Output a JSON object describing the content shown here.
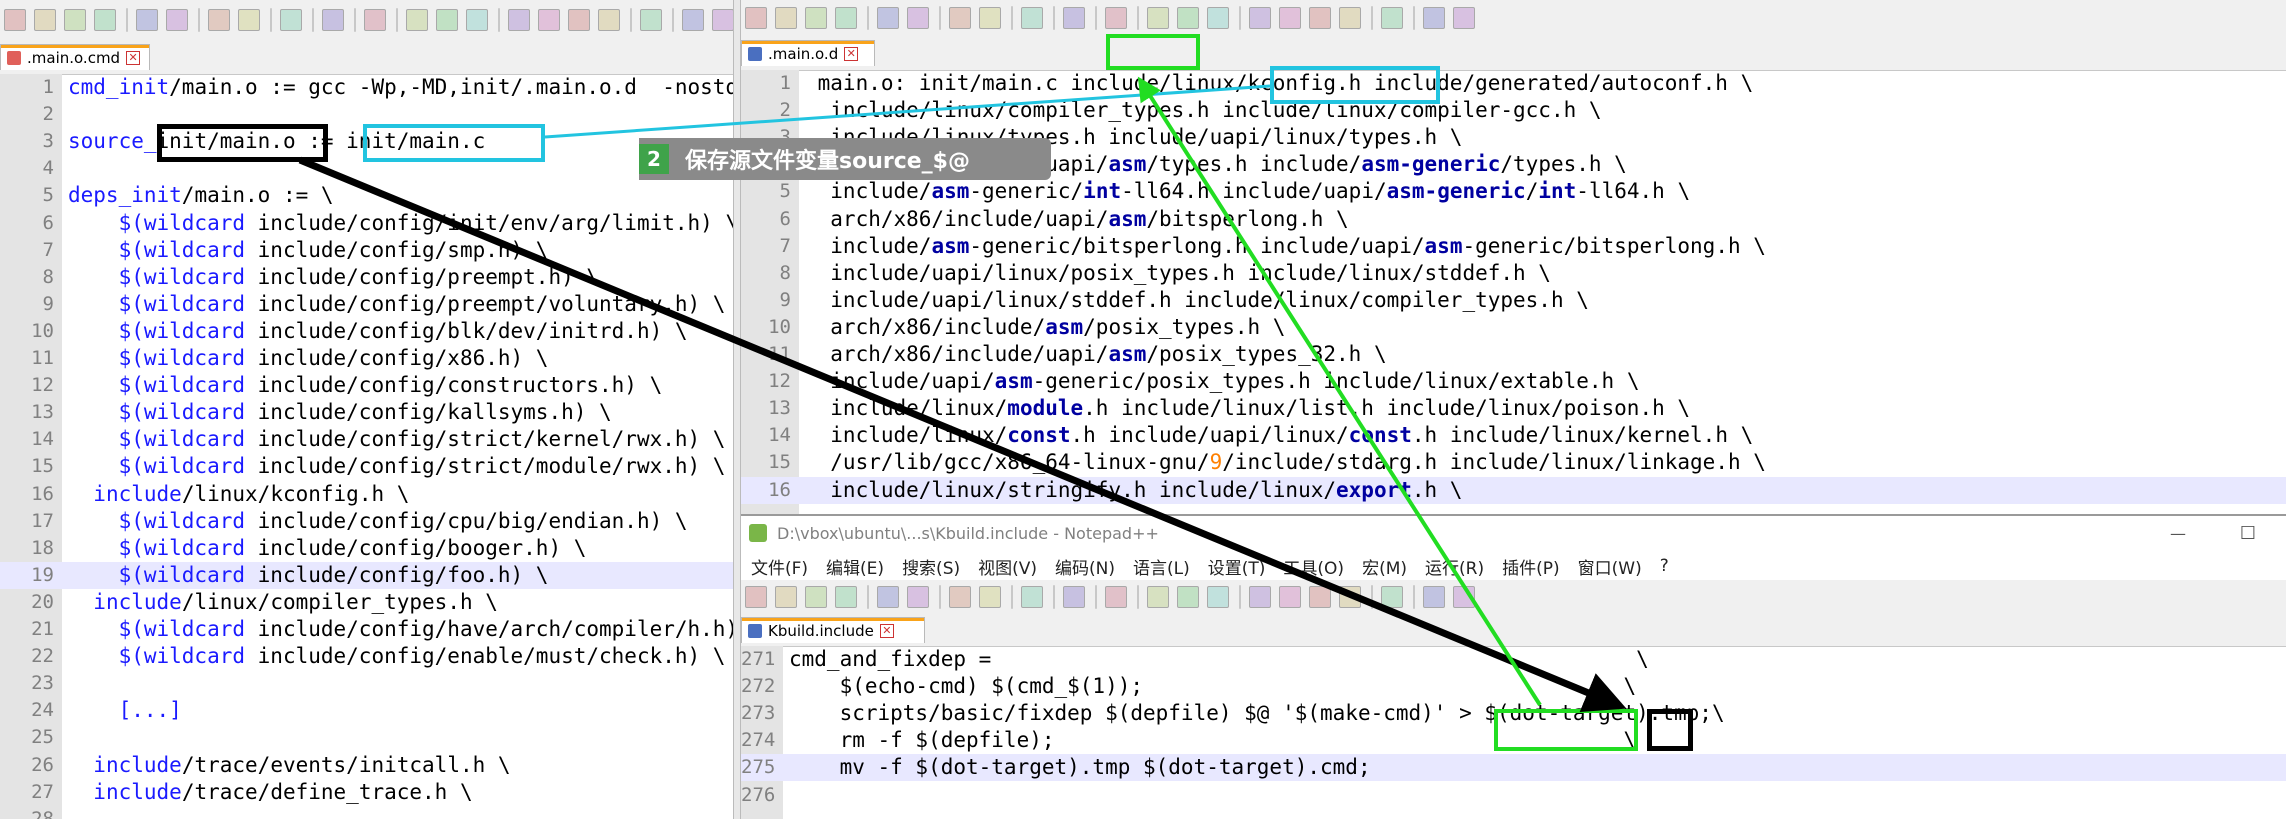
{
  "left_tab": {
    "label": ".main.o.cmd"
  },
  "left_lines": [
    {
      "n": "1",
      "t": [
        [
          "v",
          "cmd_init"
        ],
        [
          "p",
          "/main.o := gcc -Wp,-MD,init/.main.o.d  -nostdinc -isystem /usr/l"
        ]
      ]
    },
    {
      "n": "2",
      "t": []
    },
    {
      "n": "3",
      "t": [
        [
          "v",
          "source_"
        ],
        [
          "p",
          "init/main.o := init/main.c"
        ]
      ]
    },
    {
      "n": "4",
      "t": []
    },
    {
      "n": "5",
      "t": [
        [
          "v",
          "deps_init"
        ],
        [
          "p",
          "/main.o := \\"
        ]
      ]
    },
    {
      "n": "6",
      "t": [
        [
          "v",
          "    $(wildcard"
        ],
        [
          "p",
          " include/config/init/env/arg/limit.h) \\"
        ]
      ]
    },
    {
      "n": "7",
      "t": [
        [
          "v",
          "    $(wildcard"
        ],
        [
          "p",
          " include/config/smp.h) \\"
        ]
      ]
    },
    {
      "n": "8",
      "t": [
        [
          "v",
          "    $(wildcard"
        ],
        [
          "p",
          " include/config/preempt.h) \\"
        ]
      ]
    },
    {
      "n": "9",
      "t": [
        [
          "v",
          "    $(wildcard"
        ],
        [
          "p",
          " include/config/preempt/voluntary.h) \\"
        ]
      ]
    },
    {
      "n": "10",
      "t": [
        [
          "v",
          "    $(wildcard"
        ],
        [
          "p",
          " include/config/blk/dev/initrd.h) \\"
        ]
      ]
    },
    {
      "n": "11",
      "t": [
        [
          "v",
          "    $(wildcard"
        ],
        [
          "p",
          " include/config/x86.h) \\"
        ]
      ]
    },
    {
      "n": "12",
      "t": [
        [
          "v",
          "    $(wildcard"
        ],
        [
          "p",
          " include/config/constructors.h) \\"
        ]
      ]
    },
    {
      "n": "13",
      "t": [
        [
          "v",
          "    $(wildcard"
        ],
        [
          "p",
          " include/config/kallsyms.h) \\"
        ]
      ]
    },
    {
      "n": "14",
      "t": [
        [
          "v",
          "    $(wildcard"
        ],
        [
          "p",
          " include/config/strict/kernel/rwx.h) \\"
        ]
      ]
    },
    {
      "n": "15",
      "t": [
        [
          "v",
          "    $(wildcard"
        ],
        [
          "p",
          " include/config/strict/module/rwx.h) \\"
        ]
      ]
    },
    {
      "n": "16",
      "t": [
        [
          "p",
          "  "
        ],
        [
          "v",
          "include"
        ],
        [
          "p",
          "/linux/kconfig.h \\"
        ]
      ]
    },
    {
      "n": "17",
      "t": [
        [
          "v",
          "    $(wildcard"
        ],
        [
          "p",
          " include/config/cpu/big/endian.h) \\"
        ]
      ]
    },
    {
      "n": "18",
      "t": [
        [
          "v",
          "    $(wildcard"
        ],
        [
          "p",
          " include/config/booger.h) \\"
        ]
      ]
    },
    {
      "n": "19",
      "t": [
        [
          "v",
          "    $(wildcard"
        ],
        [
          "p",
          " include/config/foo.h) \\"
        ]
      ]
    },
    {
      "n": "20",
      "t": [
        [
          "p",
          "  "
        ],
        [
          "v",
          "include"
        ],
        [
          "p",
          "/linux/compiler_types.h \\"
        ]
      ]
    },
    {
      "n": "21",
      "t": [
        [
          "v",
          "    $(wildcard"
        ],
        [
          "p",
          " include/config/have/arch/compiler/h.h) \\"
        ]
      ]
    },
    {
      "n": "22",
      "t": [
        [
          "v",
          "    $(wildcard"
        ],
        [
          "p",
          " include/config/enable/must/check.h) \\"
        ]
      ]
    },
    {
      "n": "23",
      "t": []
    },
    {
      "n": "24",
      "t": [
        [
          "v",
          "    [...]"
        ]
      ]
    },
    {
      "n": "25",
      "t": []
    },
    {
      "n": "26",
      "t": [
        [
          "p",
          "  "
        ],
        [
          "v",
          "include"
        ],
        [
          "p",
          "/trace/events/initcall.h \\"
        ]
      ]
    },
    {
      "n": "27",
      "t": [
        [
          "p",
          "  "
        ],
        [
          "v",
          "include"
        ],
        [
          "p",
          "/trace/define_trace.h \\"
        ]
      ]
    },
    {
      "n": "28",
      "t": []
    }
  ],
  "right_tab": {
    "label": ".main.o.d"
  },
  "right_lines": [
    {
      "n": "1",
      "t": [
        [
          "p",
          " main.o: init/main.c include/linux/kconfig.h include/generated/autoconf.h \\"
        ]
      ]
    },
    {
      "n": "2",
      "t": [
        [
          "p",
          "  include/linux/compiler_types.h include/linux/compiler-gcc.h \\"
        ]
      ]
    },
    {
      "n": "3",
      "t": [
        [
          "p",
          "  include/linux/types.h include/uapi/linux/types.h \\"
        ]
      ]
    },
    {
      "n": "4",
      "t": [
        [
          "p",
          "  arch/x86/include/uapi/"
        ],
        [
          "k",
          "asm"
        ],
        [
          "p",
          "/types.h include/"
        ],
        [
          "k",
          "asm-generic"
        ],
        [
          "p",
          "/types.h \\"
        ]
      ]
    },
    {
      "n": "5",
      "t": [
        [
          "p",
          "  include/"
        ],
        [
          "k",
          "asm"
        ],
        [
          "p",
          "-generic/"
        ],
        [
          "k",
          "int"
        ],
        [
          "p",
          "-ll64.h include/uapi/"
        ],
        [
          "k",
          "asm-generic"
        ],
        [
          "p",
          "/"
        ],
        [
          "k",
          "int"
        ],
        [
          "p",
          "-ll64.h \\"
        ]
      ]
    },
    {
      "n": "6",
      "t": [
        [
          "p",
          "  arch/x86/include/uapi/"
        ],
        [
          "k",
          "asm"
        ],
        [
          "p",
          "/bitsperlong.h \\"
        ]
      ]
    },
    {
      "n": "7",
      "t": [
        [
          "p",
          "  include/"
        ],
        [
          "k",
          "asm"
        ],
        [
          "p",
          "-generic/bitsperlong.h include/uapi/"
        ],
        [
          "k",
          "asm"
        ],
        [
          "p",
          "-generic/bitsperlong.h \\"
        ]
      ]
    },
    {
      "n": "8",
      "t": [
        [
          "p",
          "  include/uapi/linux/posix_types.h include/linux/stddef.h \\"
        ]
      ]
    },
    {
      "n": "9",
      "t": [
        [
          "p",
          "  include/uapi/linux/stddef.h include/linux/compiler_types.h \\"
        ]
      ]
    },
    {
      "n": "10",
      "t": [
        [
          "p",
          "  arch/x86/include/"
        ],
        [
          "k",
          "asm"
        ],
        [
          "p",
          "/posix_types.h \\"
        ]
      ]
    },
    {
      "n": "11",
      "t": [
        [
          "p",
          "  arch/x86/include/uapi/"
        ],
        [
          "k",
          "asm"
        ],
        [
          "p",
          "/posix_types_32.h \\"
        ]
      ]
    },
    {
      "n": "12",
      "t": [
        [
          "p",
          "  include/uapi/"
        ],
        [
          "k",
          "asm"
        ],
        [
          "p",
          "-generic/posix_types.h include/linux/extable.h \\"
        ]
      ]
    },
    {
      "n": "13",
      "t": [
        [
          "p",
          "  include/linux/"
        ],
        [
          "k",
          "module"
        ],
        [
          "p",
          ".h include/linux/list.h include/linux/poison.h \\"
        ]
      ]
    },
    {
      "n": "14",
      "t": [
        [
          "p",
          "  include/linux/"
        ],
        [
          "k",
          "const"
        ],
        [
          "p",
          ".h include/uapi/linux/"
        ],
        [
          "k",
          "const"
        ],
        [
          "p",
          ".h include/linux/kernel.h \\"
        ]
      ]
    },
    {
      "n": "15",
      "t": [
        [
          "p",
          "  /usr/lib/gcc/x86_64-linux-gnu/"
        ],
        [
          "n",
          "9"
        ],
        [
          "p",
          "/include/stdarg.h include/linux/linkage.h \\"
        ]
      ]
    },
    {
      "n": "16",
      "t": [
        [
          "p",
          "  include/linux/stringify.h include/linux/"
        ],
        [
          "k",
          "export"
        ],
        [
          "p",
          ".h \\"
        ]
      ]
    }
  ],
  "window": {
    "title": "D:\\vbox\\ubuntu\\...s\\Kbuild.include - Notepad++",
    "minimize": "—",
    "maximize": "☐"
  },
  "menu": [
    "文件(F)",
    "编辑(E)",
    "搜索(S)",
    "视图(V)",
    "编码(N)",
    "语言(L)",
    "设置(T)",
    "工具(O)",
    "宏(M)",
    "运行(R)",
    "插件(P)",
    "窗口(W)",
    "?"
  ],
  "bottom_tab": {
    "label": "Kbuild.include"
  },
  "bottom_lines": [
    {
      "n": "271",
      "t": [
        [
          "p",
          "cmd_and_fixdep =                                                   \\"
        ]
      ]
    },
    {
      "n": "272",
      "t": [
        [
          "p",
          "    $(echo-cmd) $(cmd_$(1));                                      \\"
        ]
      ]
    },
    {
      "n": "273",
      "t": [
        [
          "p",
          "    scripts/basic/fixdep $(depfile) $@ '$(make-cmd)' > $(dot-target).tmp;\\"
        ]
      ]
    },
    {
      "n": "274",
      "t": [
        [
          "p",
          "    rm -f $(depfile);                                             \\"
        ]
      ]
    },
    {
      "n": "275",
      "t": [
        [
          "p",
          "    mv -f $(dot-target).tmp $(dot-target).cmd;"
        ]
      ]
    },
    {
      "n": "276",
      "t": []
    }
  ],
  "callout": {
    "badge": "2",
    "text": "保存源文件变量source_$@"
  },
  "colors": {
    "cyan": "#22c4e0",
    "green": "#22dd22",
    "black": "#000000",
    "callout": "#8a8a8a",
    "badge": "#3fa34a"
  }
}
